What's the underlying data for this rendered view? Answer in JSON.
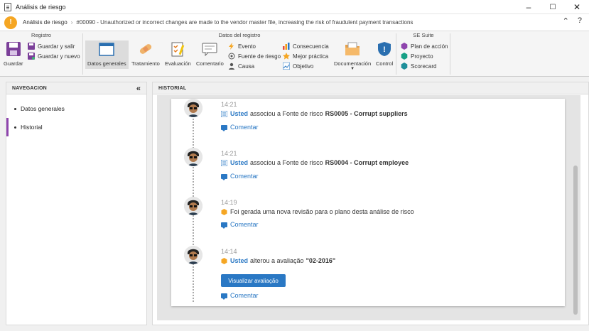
{
  "window": {
    "title": "Análisis de riesgo",
    "controls": [
      "–",
      "☐",
      "✕"
    ]
  },
  "header": {
    "breadcrumb_root": "Análisis de riesgo",
    "separator": "›",
    "record": "#00090 - Unauthorized or incorrect changes are made to the vendor master file, increasing the risk of fraudulent payment transactions"
  },
  "ribbon": {
    "groups": {
      "registro": "Registro",
      "datos_registro": "Datos del registro",
      "se_suite": "SE Suite"
    },
    "registro": {
      "guardar": "Guardar",
      "guardar_salir": "Guardar y salir",
      "guardar_nuevo": "Guardar y nuevo"
    },
    "datos": {
      "datos_generales": "Datos generales",
      "tratamiento": "Tratamiento",
      "evaluacion": "Evaluación",
      "comentario": "Comentario",
      "evento": "Evento",
      "fuente_riesgo": "Fuente de riesgo",
      "causa": "Causa",
      "consecuencia": "Consecuencia",
      "mejor_practica": "Mejor práctica",
      "objetivo": "Objetivo",
      "documentacion": "Documentación",
      "control": "Control"
    },
    "suite": {
      "plan_accion": "Plan de acción",
      "proyecto": "Proyecto",
      "scorecard": "Scorecard"
    }
  },
  "navigation": {
    "title": "NAVEGACION",
    "collapse_glyph": "«",
    "items": [
      {
        "label": "Datos generales",
        "active": false
      },
      {
        "label": "Historial",
        "active": true
      }
    ]
  },
  "history": {
    "title": "HISTORIAL",
    "comment_label": "Comentar",
    "entries": [
      {
        "time": "14:21",
        "user": "Usted",
        "text": "associou a Fonte de risco",
        "bold": "RS0005 - Corrupt suppliers"
      },
      {
        "time": "14:21",
        "user": "Usted",
        "text": "associou a Fonte de risco",
        "bold": "RS0004 - Corrupt employee"
      },
      {
        "time": "14:19",
        "user": "",
        "text": "Foi gerada uma nova revisão para o plano desta análise de risco",
        "bold": ""
      },
      {
        "time": "14:14",
        "user": "Usted",
        "text": "alterou a avaliação",
        "bold": "\"02-2016\"",
        "button": "Visualizar avaliação"
      }
    ]
  },
  "colors": {
    "accent": "#2a78c4",
    "nav_active": "#8e44ad",
    "warning": "#f5a623"
  }
}
